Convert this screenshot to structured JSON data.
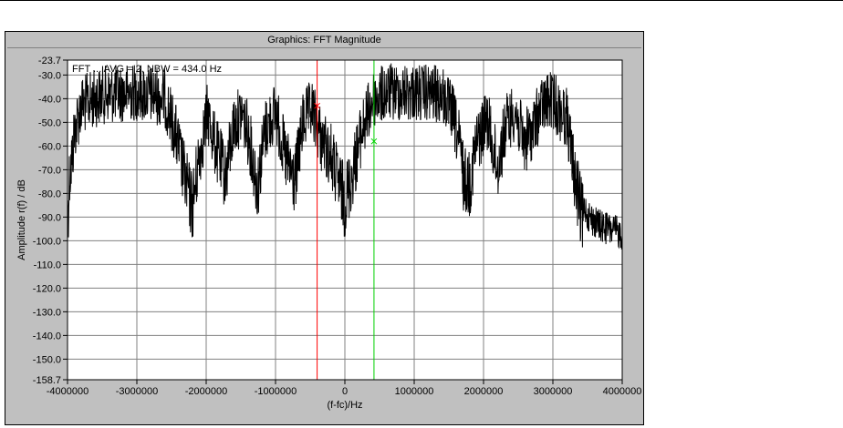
{
  "window": {
    "title": "Graphics: FFT Magnitude"
  },
  "chart_data": {
    "type": "line",
    "title": "",
    "annotation": "FFT ... AVG = 2, NBW = 434.0 Hz",
    "xlabel": "(f-fc)/Hz",
    "ylabel": "Amplitude r(f) / dB",
    "xlim": [
      -4000000,
      4000000
    ],
    "ylim": [
      -158.7,
      -23.7
    ],
    "x_ticks": [
      -4000000,
      -3000000,
      -2000000,
      -1000000,
      0,
      1000000,
      2000000,
      3000000,
      4000000
    ],
    "x_tick_labels": [
      "-4000000",
      "-3000000",
      "-2000000",
      "-1000000",
      "0",
      "1000000",
      "2000000",
      "3000000",
      "4000000"
    ],
    "y_ticks": [
      -23.7,
      -30,
      -40,
      -50,
      -60,
      -70,
      -80,
      -90,
      -100,
      -110,
      -120,
      -130,
      -140,
      -150,
      -158.7
    ],
    "y_tick_labels": [
      "-23.7",
      "-30.0",
      "-40.0",
      "-50.0",
      "-60.0",
      "-70.0",
      "-80.0",
      "-90.0",
      "-100.0",
      "-110.0",
      "-120.0",
      "-130.0",
      "-140.0",
      "-150.0",
      "-158.7"
    ],
    "grid": true,
    "colors": {
      "trace": "#000000",
      "marker_red": "#ff0000",
      "marker_green": "#00d000",
      "grid": "#808080",
      "plot_bg": "#ffffff"
    },
    "markers": [
      {
        "name": "red-marker",
        "x": -400000,
        "y": -43,
        "color": "#ff0000"
      },
      {
        "name": "green-marker",
        "x": 420000,
        "y": -58,
        "color": "#00d000"
      }
    ],
    "series": [
      {
        "envelope_x": [
          -4000000,
          -3970000,
          -3930000,
          -3900000,
          -3800000,
          -3500000,
          -3000000,
          -2600000,
          -2450000,
          -2300000,
          -2200000,
          -2100000,
          -1980000,
          -1850000,
          -1720000,
          -1600000,
          -1480000,
          -1380000,
          -1260000,
          -1150000,
          -1000000,
          -850000,
          -720000,
          -600000,
          -470000,
          -350000,
          -200000,
          -100000,
          0,
          100000,
          250000,
          400000,
          600000,
          1000000,
          1400000,
          1550000,
          1650000,
          1720000,
          1800000,
          1900000,
          2050000,
          2200000,
          2320000,
          2450000,
          2580000,
          2700000,
          2850000,
          3000000,
          3100000,
          3200000,
          3300000,
          3400000,
          3500000,
          3600000,
          3700000,
          3800000,
          3900000,
          4000000
        ],
        "envelope_y": [
          -76,
          -57,
          -50,
          -40,
          -30,
          -26,
          -25,
          -27,
          -40,
          -60,
          -70,
          -50,
          -33,
          -48,
          -58,
          -38,
          -33,
          -43,
          -62,
          -40,
          -32,
          -52,
          -60,
          -36,
          -32,
          -43,
          -50,
          -60,
          -68,
          -58,
          -40,
          -28,
          -25,
          -25,
          -26,
          -33,
          -45,
          -60,
          -60,
          -45,
          -35,
          -55,
          -38,
          -32,
          -45,
          -40,
          -30,
          -28,
          -32,
          -35,
          -55,
          -72,
          -82,
          -85,
          -87,
          -88,
          -89,
          -90
        ]
      }
    ]
  }
}
